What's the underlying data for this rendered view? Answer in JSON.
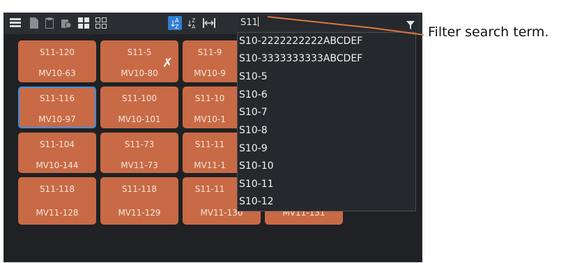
{
  "toolbar": {
    "icons": [
      "list-view-icon",
      "document-icon",
      "clipboard-icon",
      "delete-icon",
      "large-grid-icon",
      "small-grid-icon",
      "sort-az-icon",
      "sort-za-icon",
      "fit-width-icon",
      "filter-icon"
    ],
    "search_value": "S11",
    "active_icon": "sort-az-icon",
    "accent_color": "#2f7fd3"
  },
  "tiles": [
    {
      "top": "S11-120",
      "bottom": "MV10-63"
    },
    {
      "top": "S11-5",
      "bottom": "MV10-80"
    },
    {
      "top": "S11-9",
      "bottom": "MV10-9"
    },
    {
      "top": "S11-116",
      "bottom": "MV10-97"
    },
    {
      "top": "S11-100",
      "bottom": "MV10-101"
    },
    {
      "top": "S11-10",
      "bottom": "MV10-1"
    },
    {
      "top": "S11-104",
      "bottom": "MV10-144"
    },
    {
      "top": "S11-73",
      "bottom": "MV11-73"
    },
    {
      "top": "S11-11",
      "bottom": "MV11-1"
    },
    {
      "top": "S11-118",
      "bottom": "MV11-128"
    },
    {
      "top": "S11-118",
      "bottom": "MV11-129"
    },
    {
      "top": "S11-11",
      "bottom": "MV11-130"
    },
    {
      "top": "",
      "bottom": "MV11-131"
    }
  ],
  "tile_color": "#c86a45",
  "dropdown": {
    "items": [
      "S10-2222222222ABCDEF",
      "S10-3333333333ABCDEF",
      "S10-5",
      "S10-6",
      "S10-7",
      "S10-8",
      "S10-9",
      "S10-10",
      "S10-11",
      "S10-12"
    ]
  },
  "callout": {
    "text": "Filter search term."
  }
}
